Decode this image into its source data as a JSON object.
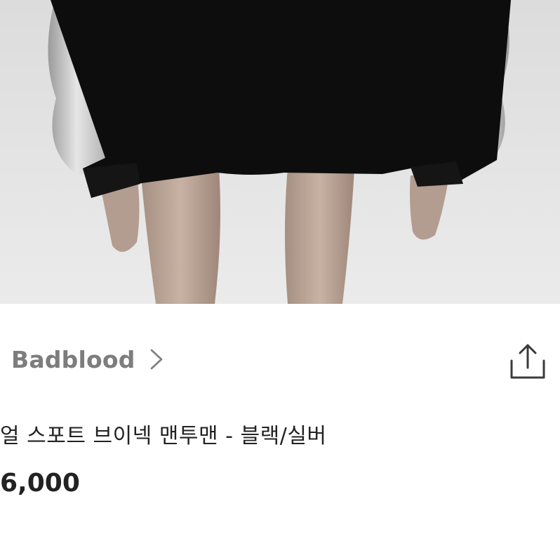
{
  "product": {
    "brand": "Badblood",
    "title": "얼 스포트 브이넥 맨투맨 - 블랙/실버",
    "price": "6,000"
  },
  "icons": {
    "brand_arrow": "chevron-right-icon",
    "share": "share-icon"
  },
  "colors": {
    "brand_text": "#7d7d7d",
    "body_text": "#222222",
    "photo_bg": "#e3e3e3",
    "garment": "#0d0d0d",
    "satin": "#c8c8c8"
  }
}
